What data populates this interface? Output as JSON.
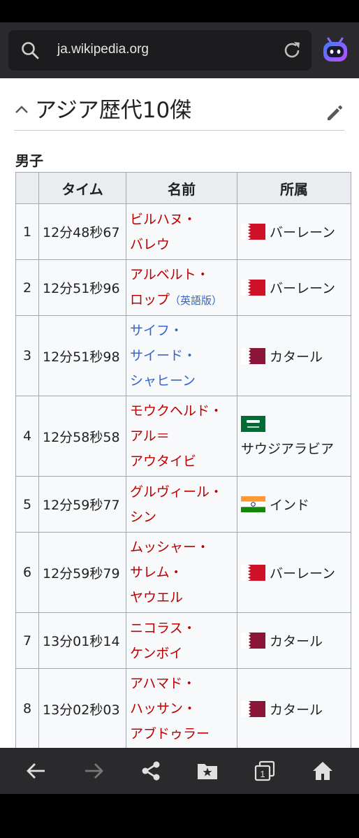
{
  "browser": {
    "url": "ja.wikipedia.org"
  },
  "section": {
    "title": "アジア歴代10傑",
    "subheading": "男子"
  },
  "table": {
    "headers": [
      "",
      "タイム",
      "名前",
      "所属"
    ],
    "rows": [
      {
        "rank": "1",
        "time": "12分48秒67",
        "name_lines": [
          "ビルハヌ・",
          "バレウ"
        ],
        "name_color": "red",
        "name_extra": "",
        "flag": "bahrain",
        "affiliation": "バーレーン",
        "aff_newline": false
      },
      {
        "rank": "2",
        "time": "12分51秒96",
        "name_lines": [
          "アルベルト・",
          "ロップ"
        ],
        "name_color": "red",
        "name_extra": "（英語版）",
        "flag": "bahrain",
        "affiliation": "バーレーン",
        "aff_newline": false
      },
      {
        "rank": "3",
        "time": "12分51秒98",
        "name_lines": [
          "サイフ・",
          "サイード・",
          "シャヒーン"
        ],
        "name_color": "blue",
        "name_extra": "",
        "flag": "qatar",
        "affiliation": "カタール",
        "aff_newline": false
      },
      {
        "rank": "4",
        "time": "12分58秒58",
        "name_lines": [
          "モウクヘルド・",
          "アル＝",
          "アウタイビ"
        ],
        "name_color": "red",
        "name_extra": "",
        "flag": "saudi",
        "affiliation": "サウジアラビア",
        "aff_newline": true
      },
      {
        "rank": "5",
        "time": "12分59秒77",
        "name_lines": [
          "グルヴィール・",
          "シン"
        ],
        "name_color": "red",
        "name_extra": "",
        "flag": "india",
        "affiliation": "インド",
        "aff_newline": false
      },
      {
        "rank": "6",
        "time": "12分59秒79",
        "name_lines": [
          "ムッシャー・",
          "サレム・",
          "ヤウエル"
        ],
        "name_color": "red",
        "name_extra": "",
        "flag": "bahrain",
        "affiliation": "バーレーン",
        "aff_newline": false
      },
      {
        "rank": "7",
        "time": "13分01秒14",
        "name_lines": [
          "ニコラス・",
          "ケンボイ"
        ],
        "name_color": "red",
        "name_extra": "",
        "flag": "qatar",
        "affiliation": "カタール",
        "aff_newline": false
      },
      {
        "rank": "8",
        "time": "13分02秒03",
        "name_lines": [
          "アハマド・",
          "ハッサン・",
          "アブドゥラー"
        ],
        "name_color": "red",
        "name_extra": "",
        "flag": "qatar",
        "affiliation": "カタール",
        "aff_newline": false
      }
    ]
  },
  "nav": {
    "tab_count": "1"
  },
  "colors": {
    "link_red": "#ba0000",
    "link_blue": "#3366cc",
    "bahrain": "#ce1126",
    "qatar": "#8a1538",
    "saudi": "#006c35",
    "india_saffron": "#ff9933",
    "india_green": "#138808"
  }
}
